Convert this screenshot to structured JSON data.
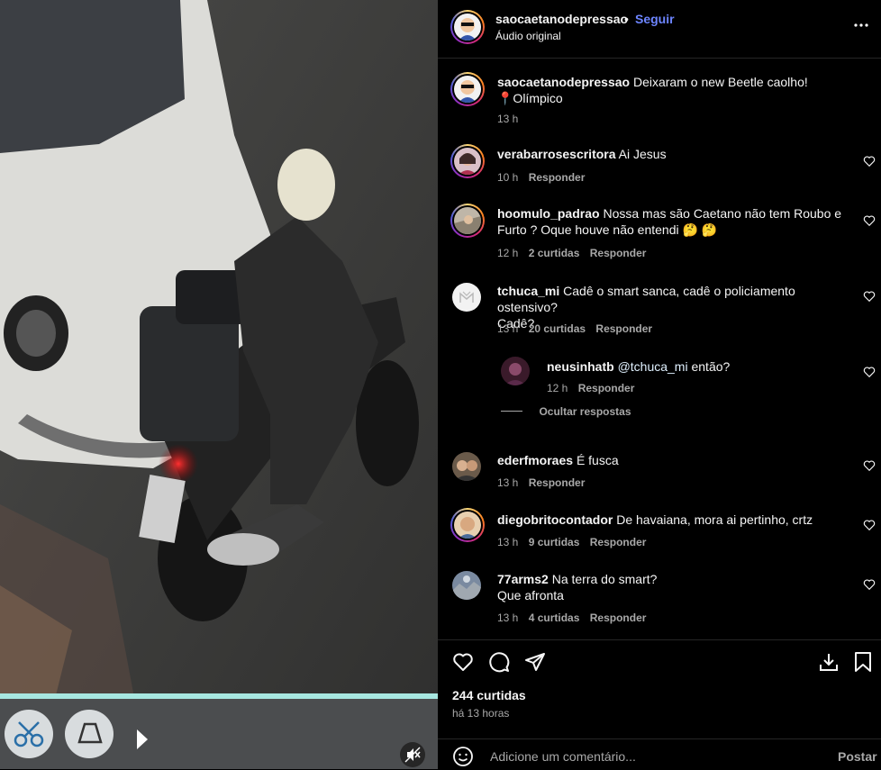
{
  "post": {
    "username": "saocaetanodepressao",
    "separator": "•",
    "follow_label": "Seguir",
    "audio": "Áudio original",
    "more_icon": "more-dots-icon"
  },
  "caption": {
    "username": "saocaetanodepressao",
    "text_line1": "Deixaram o new Beetle caolho!",
    "text_line2": "📍Olímpico",
    "time": "13 h"
  },
  "comments": [
    {
      "username": "verabarrosescritora",
      "text": "Ai Jesus",
      "text2": "",
      "time": "10 h",
      "likes": "",
      "reply": "Responder"
    },
    {
      "username": "hoomulo_padrao",
      "text": "Nossa mas são Caetano não tem Roubo e",
      "text2": "Furto ? Oque houve não entendi 🤔 🤔",
      "time": "12 h",
      "likes": "2 curtidas",
      "reply": "Responder"
    },
    {
      "username": "tchuca_mi",
      "text": "Cadê o smart sanca, cadê o policiamento ostensivo?",
      "text2": "Cadê?",
      "time": "13 h",
      "likes": "20 curtidas",
      "reply": "Responder"
    },
    {
      "username": "ederfmoraes",
      "text": "É fusca",
      "text2": "",
      "time": "13 h",
      "likes": "",
      "reply": "Responder"
    },
    {
      "username": "diegobritocontador",
      "text": "De havaiana, mora ai pertinho, crtz",
      "text2": "",
      "time": "13 h",
      "likes": "9 curtidas",
      "reply": "Responder"
    },
    {
      "username": "77arms2",
      "text": "Na terra do smart?",
      "text2": "Que afronta",
      "time": "13 h",
      "likes": "4 curtidas",
      "reply": "Responder"
    }
  ],
  "reply": {
    "username": "neusinhatb",
    "mention": "@tchuca_mi",
    "text": "então?",
    "time": "12 h",
    "reply": "Responder",
    "hide_label": "Ocultar respostas"
  },
  "footer": {
    "likes": "244 curtidas",
    "time": "há 13 horas",
    "comment_placeholder": "Adicione um comentário...",
    "post_label": "Postar"
  },
  "colors": {
    "accent": "#0095f6",
    "follow": "#6d85ff",
    "background": "#000000",
    "secondary_text": "#a8a8a8"
  }
}
